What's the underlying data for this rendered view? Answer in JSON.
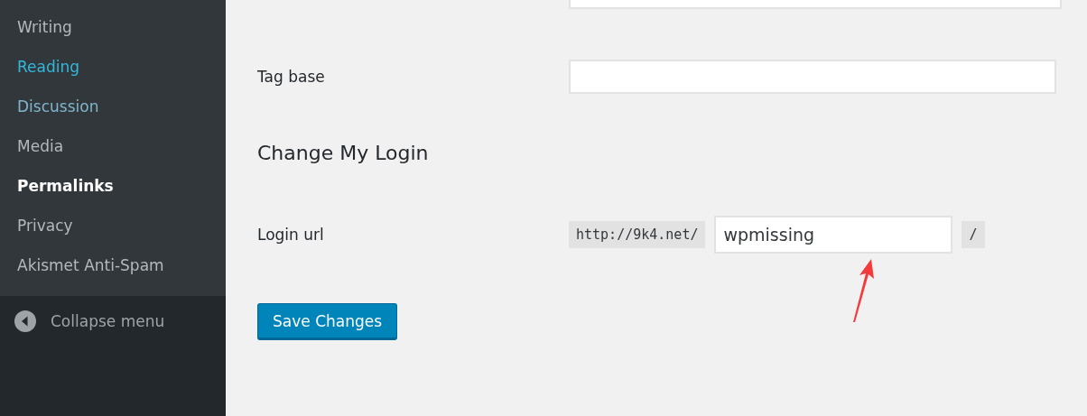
{
  "sidebar": {
    "items": [
      {
        "label": "Writing",
        "selected": false,
        "color": "#b4b9be"
      },
      {
        "label": "Reading",
        "selected": false,
        "color": "#33b8db"
      },
      {
        "label": "Discussion",
        "selected": false,
        "color": "#7fb6cc"
      },
      {
        "label": "Media",
        "selected": false,
        "color": "#b4b9be"
      },
      {
        "label": "Permalinks",
        "selected": true,
        "color": "#ffffff"
      },
      {
        "label": "Privacy",
        "selected": false,
        "color": "#b4b9be"
      },
      {
        "label": "Akismet Anti-Spam",
        "selected": false,
        "color": "#b4b9be"
      }
    ],
    "collapse": {
      "label": "Collapse menu"
    }
  },
  "form": {
    "rows": [
      {
        "kind": "text",
        "label": "Tag base"
      }
    ],
    "section_title": "Change My Login",
    "login": {
      "label": "Login url",
      "prefix": "http://9k4.net/",
      "value": "wpmissing",
      "suffix": "/"
    },
    "save_button": "Save Changes"
  }
}
